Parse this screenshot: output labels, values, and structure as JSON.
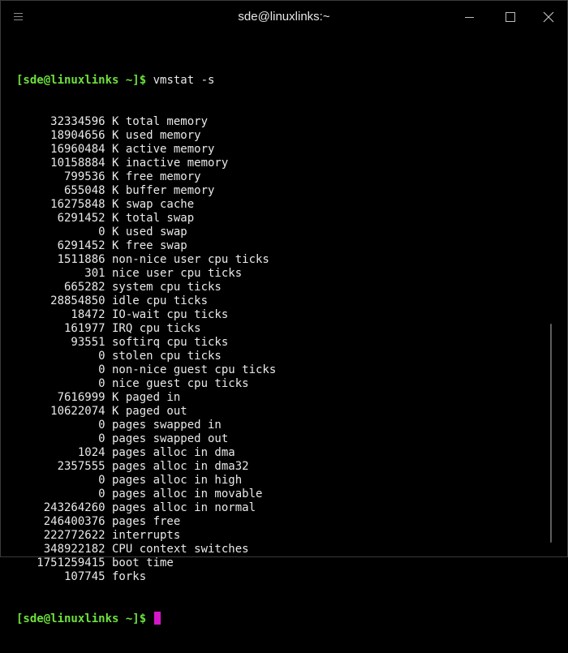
{
  "window": {
    "title": "sde@linuxlinks:~",
    "menu_icon": "hamburger-icon",
    "minimize_icon": "minimize-icon",
    "maximize_icon": "maximize-icon",
    "close_icon": "close-icon"
  },
  "terminal": {
    "prompt": "[sde@linuxlinks ~]$",
    "command": " vmstat -s",
    "output": [
      "     32334596 K total memory",
      "     18904656 K used memory",
      "     16960484 K active memory",
      "     10158884 K inactive memory",
      "       799536 K free memory",
      "       655048 K buffer memory",
      "     16275848 K swap cache",
      "      6291452 K total swap",
      "            0 K used swap",
      "      6291452 K free swap",
      "      1511886 non-nice user cpu ticks",
      "          301 nice user cpu ticks",
      "       665282 system cpu ticks",
      "     28854850 idle cpu ticks",
      "        18472 IO-wait cpu ticks",
      "       161977 IRQ cpu ticks",
      "        93551 softirq cpu ticks",
      "            0 stolen cpu ticks",
      "            0 non-nice guest cpu ticks",
      "            0 nice guest cpu ticks",
      "      7616999 K paged in",
      "     10622074 K paged out",
      "            0 pages swapped in",
      "            0 pages swapped out",
      "         1024 pages alloc in dma",
      "      2357555 pages alloc in dma32",
      "            0 pages alloc in high",
      "            0 pages alloc in movable",
      "    243264260 pages alloc in normal",
      "    246400376 pages free",
      "    222772622 interrupts",
      "    348922182 CPU context switches",
      "   1751259415 boot time",
      "       107745 forks"
    ],
    "final_prompt": "[sde@linuxlinks ~]$",
    "colors": {
      "prompt": "#6ee03c",
      "text": "#e9e9e9",
      "cursor": "#d617c8",
      "background": "#000000"
    }
  }
}
